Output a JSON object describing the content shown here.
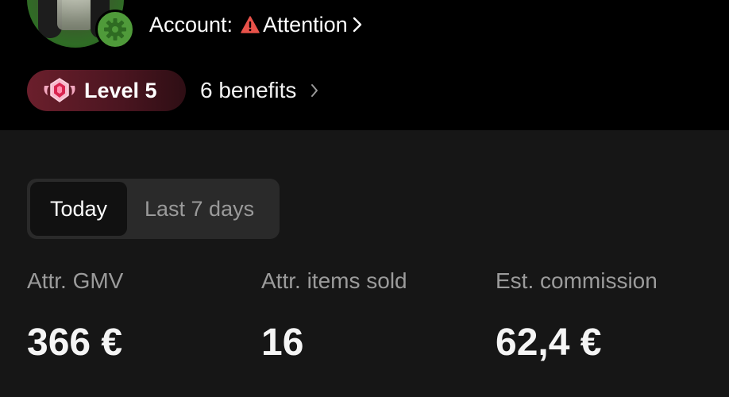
{
  "profile": {
    "account_label": "Account:",
    "account_status": "Attention",
    "level_label": "Level 5",
    "benefits_label": "6 benefits"
  },
  "period_tabs": [
    {
      "label": "Today",
      "selected": true
    },
    {
      "label": "Last 7 days",
      "selected": false
    }
  ],
  "metrics": [
    {
      "label": "Attr. GMV",
      "value": "366 €"
    },
    {
      "label": "Attr. items sold",
      "value": "16"
    },
    {
      "label": "Est. commission",
      "value": "62,4 €"
    }
  ],
  "colors": {
    "background": "#161616",
    "header_background": "#000000",
    "warning": "#e8524a",
    "level_pill": "#6b1f2c",
    "settings_badge": "#4f9a3a"
  },
  "icons": {
    "settings": "gear-icon",
    "warning": "warning-icon",
    "level": "level-badge-icon",
    "chevron": "chevron-right-icon"
  }
}
